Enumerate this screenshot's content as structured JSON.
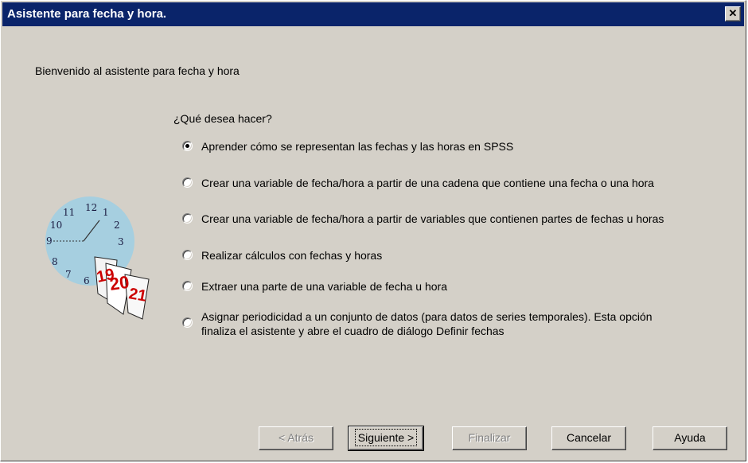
{
  "window": {
    "title": "Asistente para fecha y hora.",
    "close_symbol": "✕"
  },
  "welcome": "Bienvenido al asistente para fecha y hora",
  "question": "¿Qué desea hacer?",
  "options": [
    {
      "label": "Aprender cómo se representan las fechas y las horas en SPSS",
      "checked": true
    },
    {
      "label": "Crear una variable de fecha/hora a partir de una cadena que contiene una fecha o una hora",
      "checked": false
    },
    {
      "label": "Crear una variable de fecha/hora a partir de variables que contienen partes de fechas u horas",
      "checked": false
    },
    {
      "label": "Realizar cálculos con fechas y horas",
      "checked": false
    },
    {
      "label": "Extraer una parte de una variable de fecha u hora",
      "checked": false
    },
    {
      "label_line1": "Asignar periodicidad a un conjunto de datos (para datos de series temporales). Esta opción",
      "label_line2": "finaliza el asistente y abre el cuadro de diálogo Definir fechas",
      "checked": false
    }
  ],
  "illustration": {
    "clock_numbers": [
      "12",
      "1",
      "2",
      "3",
      "6",
      "7",
      "8",
      "9",
      "10",
      "11"
    ],
    "calendar_pages": [
      "19",
      "20",
      "21"
    ],
    "icon": "clock-calendar-icon"
  },
  "buttons": {
    "back": "< Atrás",
    "next": "Siguiente >",
    "finish": "Finalizar",
    "cancel": "Cancelar",
    "help": "Ayuda"
  },
  "colors": {
    "title_bar": "#0a246a",
    "dialog_face": "#d4d0c8",
    "clock_face": "#a6cfe0",
    "calendar_numbers": "#cc0000"
  }
}
